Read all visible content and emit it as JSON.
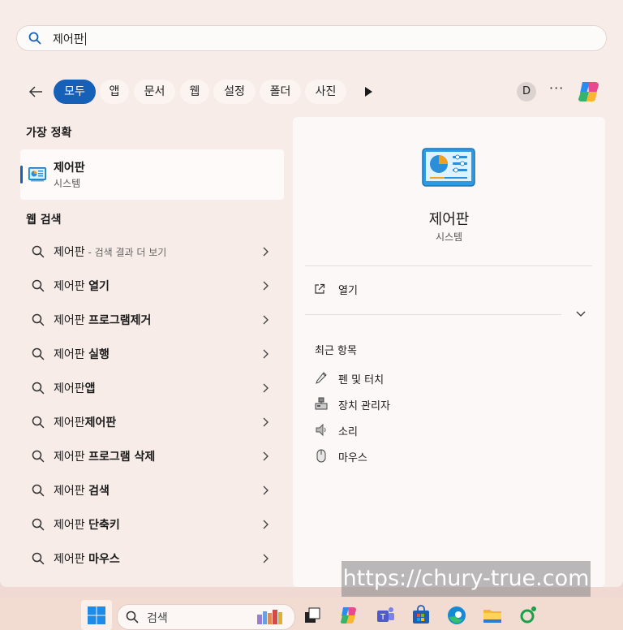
{
  "search": {
    "value": "제어판"
  },
  "filters": {
    "back_label": "뒤로",
    "tabs": [
      {
        "label": "모두",
        "active": true
      },
      {
        "label": "앱"
      },
      {
        "label": "문서"
      },
      {
        "label": "웹"
      },
      {
        "label": "설정"
      },
      {
        "label": "폴더"
      },
      {
        "label": "사진"
      }
    ],
    "avatar_initial": "D",
    "ellipsis": "···"
  },
  "best_match": {
    "heading": "가장 정확",
    "name": "제어판",
    "type": "시스템",
    "icon": "control-panel-icon"
  },
  "web_search": {
    "heading": "웹 검색",
    "items": [
      {
        "prefix": "제어판",
        "suffix": "",
        "hint": " - 검색 결과 더 보기"
      },
      {
        "prefix": "제어판 ",
        "suffix": "열기",
        "hint": ""
      },
      {
        "prefix": "제어판 ",
        "suffix": "프로그램제거",
        "hint": ""
      },
      {
        "prefix": "제어판 ",
        "suffix": "실행",
        "hint": ""
      },
      {
        "prefix": "제어판",
        "suffix": "앱",
        "hint": ""
      },
      {
        "prefix": "제어판",
        "suffix": "제어판",
        "hint": ""
      },
      {
        "prefix": "제어판 ",
        "suffix": "프로그램 삭제",
        "hint": ""
      },
      {
        "prefix": "제어판 ",
        "suffix": "검색",
        "hint": ""
      },
      {
        "prefix": "제어판 ",
        "suffix": "단축키",
        "hint": ""
      },
      {
        "prefix": "제어판 ",
        "suffix": "마우스",
        "hint": ""
      }
    ]
  },
  "detail": {
    "title": "제어판",
    "subtitle": "시스템",
    "open_label": "열기",
    "recent_heading": "최근 항목",
    "recent": [
      {
        "label": "펜 및 터치",
        "icon": "pen-icon"
      },
      {
        "label": "장치 관리자",
        "icon": "device-manager-icon"
      },
      {
        "label": "소리",
        "icon": "speaker-icon"
      },
      {
        "label": "마우스",
        "icon": "mouse-icon"
      }
    ]
  },
  "watermark": "https://chury-true.com",
  "taskbar": {
    "search_placeholder": "검색",
    "apps": [
      "task-view-icon",
      "copilot-icon",
      "teams-icon",
      "store-icon",
      "edge-icon",
      "file-explorer-icon",
      "app-icon"
    ]
  },
  "colors": {
    "accent": "#1660b8",
    "panel": "#f7ece8",
    "detail": "#fcf8f7"
  }
}
